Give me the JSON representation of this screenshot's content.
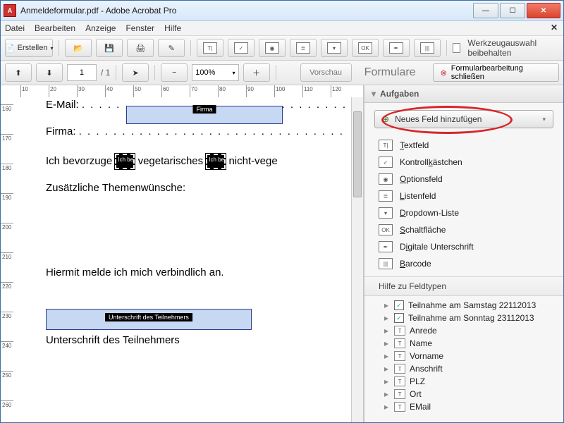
{
  "title": "Anmeldeformular.pdf - Adobe Acrobat Pro",
  "menu": {
    "items": [
      "Datei",
      "Bearbeiten",
      "Anzeige",
      "Fenster",
      "Hilfe"
    ]
  },
  "toolbar": {
    "create_label": "Erstellen",
    "tool_select_keep": "Werkzeugauswahl beibehalten"
  },
  "nav": {
    "page_current": "1",
    "page_total": "1",
    "zoom": "100%",
    "preview": "Vorschau",
    "mode": "Formulare",
    "close_editing": "Formularbearbeitung schließen"
  },
  "ruler_h": [
    "10",
    "20",
    "30",
    "40",
    "50",
    "60",
    "70",
    "80",
    "90",
    "100",
    "110",
    "120"
  ],
  "ruler_v": [
    "160",
    "170",
    "180",
    "190",
    "200",
    "210",
    "220",
    "230",
    "240",
    "250",
    "260"
  ],
  "doc": {
    "email_label": "E-Mail: ",
    "firma_field": "Firma",
    "firma_label": "Firma: ",
    "pref_line_a": "Ich bevorzuge ",
    "pref_line_b": " vegetarisches ",
    "pref_line_c": " nicht-vege",
    "rb_tag": "Ich be",
    "themen": "Zusätzliche Themenwünsche:",
    "binding": "Hiermit melde ich mich verbindlich an.",
    "sig_field": "Unterschrift des Teilnehmers",
    "sig_label": "Unterschrift des Teilnehmers"
  },
  "panel": {
    "tasks": "Aufgaben",
    "add_field": "Neues Feld hinzufügen",
    "types": [
      {
        "label_pre": "",
        "u": "T",
        "label_post": "extfeld",
        "icon": "T|"
      },
      {
        "label_pre": "Kontroll",
        "u": "k",
        "label_post": "ästchen",
        "icon": "✓"
      },
      {
        "label_pre": "",
        "u": "O",
        "label_post": "ptionsfeld",
        "icon": "◉"
      },
      {
        "label_pre": "",
        "u": "L",
        "label_post": "istenfeld",
        "icon": "≣"
      },
      {
        "label_pre": "",
        "u": "D",
        "label_post": "ropdown-Liste",
        "icon": "▾"
      },
      {
        "label_pre": "",
        "u": "S",
        "label_post": "chaltfläche",
        "icon": "OK"
      },
      {
        "label_pre": "D",
        "u": "i",
        "label_post": "gitale Unterschrift",
        "icon": "✒"
      },
      {
        "label_pre": "",
        "u": "B",
        "label_post": "arcode",
        "icon": "|||"
      }
    ],
    "types_help": "Hilfe zu Feldtypen",
    "tree": [
      {
        "kind": "check",
        "label": "Teilnahme am Samstag 22112013"
      },
      {
        "kind": "check",
        "label": "Teilnahme am Sonntag 23112013"
      },
      {
        "kind": "text",
        "label": "Anrede"
      },
      {
        "kind": "text",
        "label": "Name"
      },
      {
        "kind": "text",
        "label": "Vorname"
      },
      {
        "kind": "text",
        "label": "Anschrift"
      },
      {
        "kind": "text",
        "label": "PLZ"
      },
      {
        "kind": "text",
        "label": "Ort"
      },
      {
        "kind": "text",
        "label": "EMail"
      }
    ]
  }
}
